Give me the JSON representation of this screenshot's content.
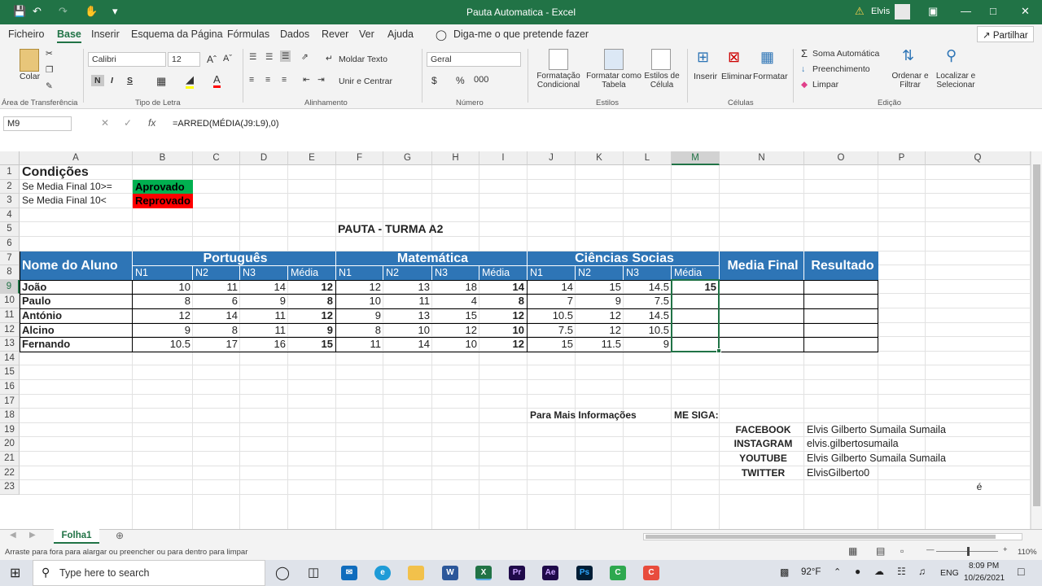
{
  "window": {
    "title": "Pauta Automatica  -  Excel",
    "user": "Elvis"
  },
  "menu": [
    "Ficheiro",
    "Base",
    "Inserir",
    "Esquema da Página",
    "Fórmulas",
    "Dados",
    "Rever",
    "Ver",
    "Ajuda"
  ],
  "tell_me": "Diga-me o que pretende fazer",
  "share": "Partilhar",
  "ribbon": {
    "colar": "Colar",
    "font_name": "Calibri",
    "font_size": "12",
    "bold": "N",
    "italic": "I",
    "underline": "S",
    "moldar": "Moldar Texto",
    "unir": "Unir e Centrar",
    "number_format": "Geral",
    "cond_format": "Formatação Condicional",
    "format_table": "Formatar como Tabela",
    "cell_styles": "Estilos de Célula",
    "inserir": "Inserir",
    "eliminar": "Eliminar",
    "formatar": "Formatar",
    "soma": "Soma Automática",
    "preench": "Preenchimento",
    "limpar": "Limpar",
    "ordenar": "Ordenar e Filtrar",
    "localizar": "Localizar e Selecionar",
    "groups": [
      "Área de Transferência",
      "Tipo de Letra",
      "Alinhamento",
      "Número",
      "Estilos",
      "Células",
      "Edição"
    ]
  },
  "formula": {
    "namebox": "M9",
    "content": "=ARRED(MÉDIA(J9:L9),0)"
  },
  "columns": [
    "A",
    "B",
    "C",
    "D",
    "E",
    "F",
    "G",
    "H",
    "I",
    "J",
    "K",
    "L",
    "M",
    "N",
    "O",
    "P",
    "Q"
  ],
  "rows": [
    "1",
    "2",
    "3",
    "4",
    "5",
    "6",
    "7",
    "8",
    "9",
    "10",
    "11",
    "12",
    "13",
    "14",
    "15",
    "16",
    "17",
    "18",
    "19",
    "20",
    "21",
    "22",
    "23"
  ],
  "sheet": {
    "condicoes": "Condições",
    "cond1": "Se Media Final 10>=",
    "cond1_result": "Aprovado",
    "cond2": "Se Media Final 10<",
    "cond2_result": "Reprovado",
    "title": "PAUTA - TURMA A2",
    "header_name": "Nome do Aluno",
    "subjects": [
      "Português",
      "Matemática",
      "Ciências Socias"
    ],
    "sub_headers": [
      "N1",
      "N2",
      "N3",
      "Média",
      "N1",
      "N2",
      "N3",
      "Média",
      "N1",
      "N2",
      "N3",
      "Média"
    ],
    "media_final": "Media Final",
    "resultado": "Resultado",
    "students": [
      {
        "name": "João",
        "values": [
          "10",
          "11",
          "14",
          "12",
          "12",
          "13",
          "18",
          "14",
          "14",
          "15",
          "14.5",
          "15"
        ]
      },
      {
        "name": "Paulo",
        "values": [
          "8",
          "6",
          "9",
          "8",
          "10",
          "11",
          "4",
          "8",
          "7",
          "9",
          "7.5",
          ""
        ]
      },
      {
        "name": "António",
        "values": [
          "12",
          "14",
          "11",
          "12",
          "9",
          "13",
          "15",
          "12",
          "10.5",
          "12",
          "14.5",
          ""
        ]
      },
      {
        "name": "Alcino",
        "values": [
          "9",
          "8",
          "11",
          "9",
          "8",
          "10",
          "12",
          "10",
          "7.5",
          "12",
          "10.5",
          ""
        ]
      },
      {
        "name": "Fernando",
        "values": [
          "10.5",
          "17",
          "16",
          "15",
          "11",
          "14",
          "10",
          "12",
          "15",
          "11.5",
          "9",
          ""
        ]
      }
    ],
    "info_label": "Para Mais Informações",
    "follow": "ME SIGA:",
    "socials": [
      {
        "net": "FACEBOOK",
        "handle": "Elvis Gilberto Sumaila Sumaila"
      },
      {
        "net": "INSTAGRAM",
        "handle": "elvis.gilbertosumaila"
      },
      {
        "net": "YOUTUBE",
        "handle": "Elvis Gilberto Sumaila Sumaila"
      },
      {
        "net": "TWITTER",
        "handle": "ElvisGilberto0"
      }
    ],
    "stray": "é"
  },
  "sheet_tab": "Folha1",
  "status": {
    "message": "Arraste para fora para alargar ou preencher ou para dentro para limpar",
    "zoom": "110%"
  },
  "taskbar": {
    "search": "Type here to search",
    "temp": "92°F",
    "lang": "ENG",
    "time": "8:09 PM",
    "date": "10/26/2021"
  },
  "colors": {
    "accent": "#217346",
    "header_blue": "#2e75b6",
    "approved": "#00b050",
    "reproved": "#ff0000"
  }
}
